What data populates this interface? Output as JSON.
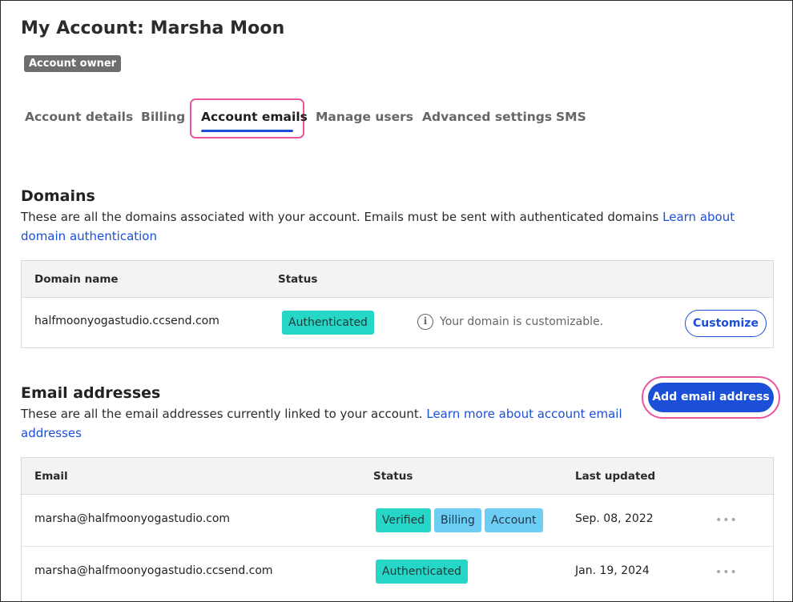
{
  "header": {
    "title": "My Account: Marsha Moon",
    "badge": "Account owner"
  },
  "tabs": [
    {
      "label": "Account details"
    },
    {
      "label": "Billing"
    },
    {
      "label": "Account emails",
      "active": true
    },
    {
      "label": "Manage users"
    },
    {
      "label": "Advanced settings"
    },
    {
      "label": "SMS"
    }
  ],
  "domains": {
    "title": "Domains",
    "description": "These are all the domains associated with your account. Emails must be sent with authenticated domains ",
    "link": "Learn about domain authentication",
    "columns": [
      "Domain name",
      "Status"
    ],
    "rows": [
      {
        "domain": "halfmoonyogastudio.ccsend.com",
        "status": "Authenticated",
        "info": "Your domain is customizable.",
        "action": "Customize"
      }
    ]
  },
  "emails": {
    "title": "Email addresses",
    "description": "These are all the email addresses currently linked to your account. ",
    "link": "Learn more about account email addresses",
    "add_button": "Add email address",
    "columns": [
      "Email",
      "Status",
      "Last updated"
    ],
    "rows": [
      {
        "email": "marsha@halfmoonyogastudio.com",
        "badges": [
          "Verified",
          "Billing",
          "Account"
        ],
        "updated": "Sep. 08, 2022",
        "more": "•••"
      },
      {
        "email": "marsha@halfmoonyogastudio.ccsend.com",
        "badges": [
          "Authenticated"
        ],
        "updated": "Jan. 19, 2024",
        "more": "•••"
      }
    ]
  },
  "colors": {
    "accent": "#1b4fd8",
    "highlight": "#e8559a",
    "status_green": "#26d6c7",
    "status_blue": "#6dcdf2",
    "badge_gray": "#6e6e6e"
  }
}
